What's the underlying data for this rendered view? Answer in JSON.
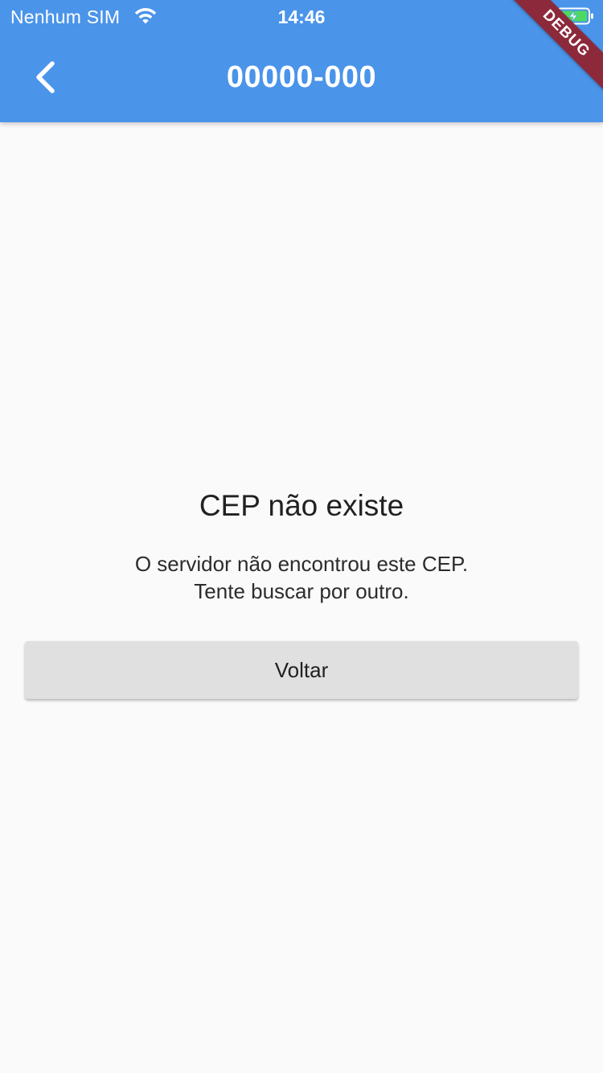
{
  "status_bar": {
    "carrier": "Nenhum SIM",
    "time": "14:46",
    "wifi_icon": "wifi-icon",
    "battery_icon": "battery-charging-icon"
  },
  "app_bar": {
    "title": "00000-000",
    "back_icon": "chevron-left-icon",
    "background_color": "#4a94ea"
  },
  "debug_banner": {
    "label": "DEBUG",
    "color": "#8c2a3c"
  },
  "message": {
    "title": "CEP não existe",
    "lines": [
      "O servidor não encontrou este CEP.",
      "Tente buscar por outro."
    ]
  },
  "actions": {
    "back_label": "Voltar"
  }
}
